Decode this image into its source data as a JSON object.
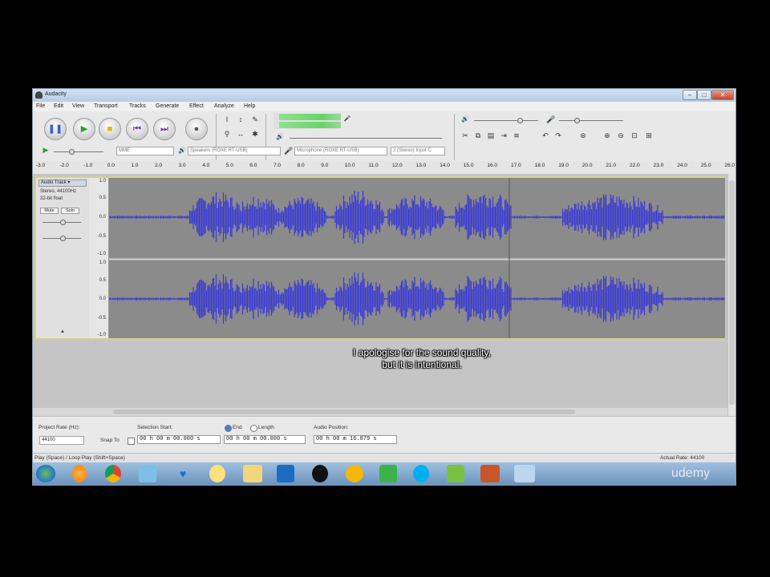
{
  "window": {
    "title": "Audacity"
  },
  "menu": [
    "File",
    "Edit",
    "View",
    "Transport",
    "Tracks",
    "Generate",
    "Effect",
    "Analyze",
    "Help"
  ],
  "transport": {
    "buttons": [
      "pause",
      "play",
      "stop",
      "skip-start",
      "skip-end",
      "record"
    ]
  },
  "devices": {
    "host": "MME",
    "output": "Speakers (ROXE RT-USB)",
    "input": "Microphone (ROXE RT-USB)",
    "channels": "2 (Stereo) Input C"
  },
  "timeline": [
    "-3.0",
    "-2.0",
    "-1.0",
    "0.0",
    "1.0",
    "2.0",
    "3.0",
    "4.0",
    "5.0",
    "6.0",
    "7.0",
    "8.0",
    "9.0",
    "10.0",
    "11.0",
    "12.0",
    "13.0",
    "14.0",
    "15.0",
    "16.0",
    "17.0",
    "18.0",
    "19.0",
    "20.0",
    "21.0",
    "22.0",
    "23.0",
    "24.0",
    "25.0",
    "26.0"
  ],
  "track": {
    "name": "Audio Track",
    "info_line1": "Stereo, 44100Hz",
    "info_line2": "32-bit float",
    "mute": "Mute",
    "solo": "Solo",
    "scale": [
      "1.0",
      "0.5",
      "0.0",
      "-0.5",
      "-1.0"
    ]
  },
  "caption": {
    "line1": "I apologise for the sound quality,",
    "line2": "but it is intentional."
  },
  "selection": {
    "project_rate_label": "Project Rate (Hz):",
    "project_rate": "44100",
    "snap_label": "Snap To",
    "selection_start_label": "Selection Start:",
    "end_label": "End",
    "length_label": "Length",
    "audio_position_label": "Audio Position:",
    "selection_start": "00 h 00 m 00.000 s",
    "end": "00 h 00 m 00.000 s",
    "audio_position": "00 h 00 m 16.879 s"
  },
  "status": {
    "left": "Play (Space) / Loop Play (Shift+Space)",
    "right": "Actual Rate: 44100"
  },
  "watermark": "udemy",
  "colors": {
    "waveform": "#3b3bd4",
    "track_bg": "#8b8b8b",
    "meter": "#66d466"
  }
}
